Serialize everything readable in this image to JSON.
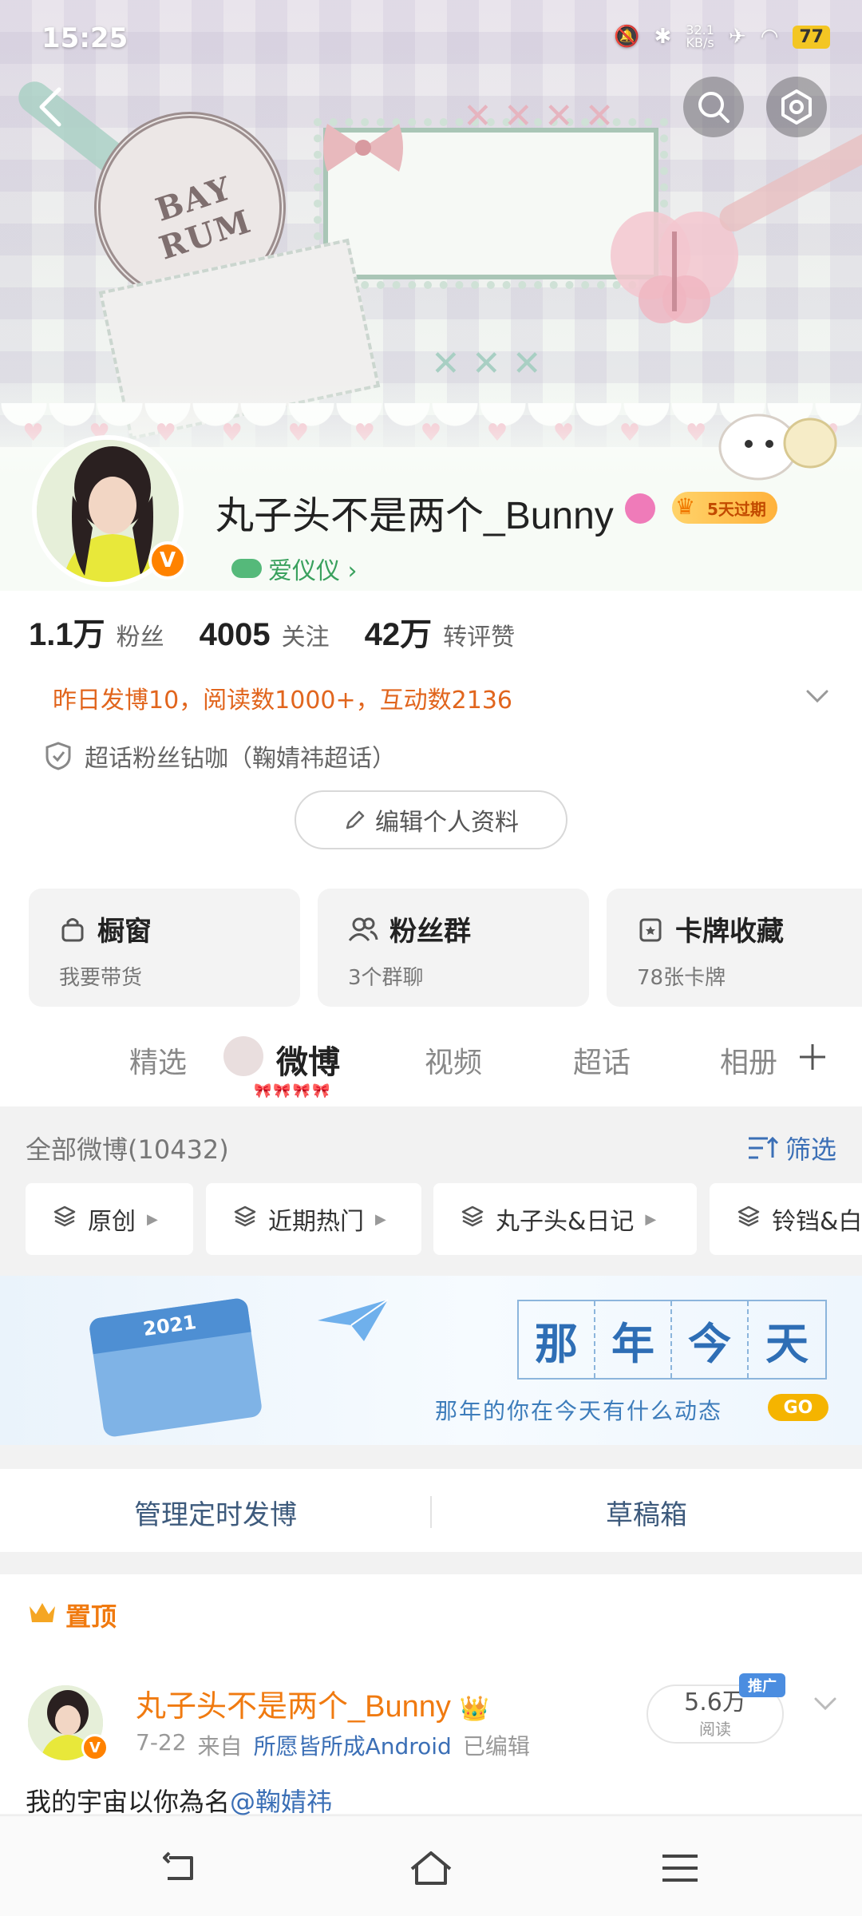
{
  "status_bar": {
    "time": "15:25",
    "net_speed": "32.1",
    "net_unit": "KB/s",
    "battery": "77"
  },
  "header": {
    "back_icon": "chevron-left-icon",
    "search_icon": "search-icon",
    "settings_icon": "gear-icon"
  },
  "profile": {
    "username": "丸子头不是两个_Bunny",
    "verified_badge": "V",
    "vip_tag": "5天过期",
    "fan_club": "爱仪仪 ›",
    "stats": [
      {
        "num": "1.1万",
        "label": "粉丝"
      },
      {
        "num": "4005",
        "label": "关注"
      },
      {
        "num": "42万",
        "label": "转评赞"
      }
    ],
    "activity": "昨日发博10，阅读数1000+，互动数2136",
    "superfan": "超话粉丝钻咖（鞠婧祎超话）",
    "edit_button": "编辑个人资料"
  },
  "cards": [
    {
      "title": "橱窗",
      "sub": "我要带货",
      "icon": "bag-icon"
    },
    {
      "title": "粉丝群",
      "sub": "3个群聊",
      "icon": "group-icon"
    },
    {
      "title": "卡牌收藏",
      "sub": "78张卡牌",
      "icon": "card-icon"
    }
  ],
  "tabs": [
    {
      "label": "精选"
    },
    {
      "label": "微博"
    },
    {
      "label": "视频"
    },
    {
      "label": "超话"
    },
    {
      "label": "相册"
    }
  ],
  "feed": {
    "all_posts": "全部微博(10432)",
    "filter": "筛选",
    "chips": [
      "原创",
      "近期热门",
      "丸子头&日记",
      "铃铛&白"
    ]
  },
  "that_year": {
    "chars": [
      "那",
      "年",
      "今",
      "天"
    ],
    "subtitle": "那年的你在今天有什么动态",
    "go": "GO",
    "calendar_year": "2021"
  },
  "management": {
    "scheduled": "管理定时发博",
    "drafts": "草稿箱"
  },
  "pinned_post": {
    "pinned_label": "置顶",
    "author": "丸子头不是两个_Bunny",
    "date": "7-22",
    "from": "来自",
    "source": "所愿皆所成Android",
    "edited": "已编辑",
    "reads": "5.6万",
    "reads_label": "阅读",
    "promo": "推广",
    "text": "我的宇宙以你為名",
    "mention": "@鞠婧祎"
  },
  "colors": {
    "accent_orange": "#f07a10",
    "link_blue": "#3b6fb6",
    "verified": "#ff8200"
  }
}
